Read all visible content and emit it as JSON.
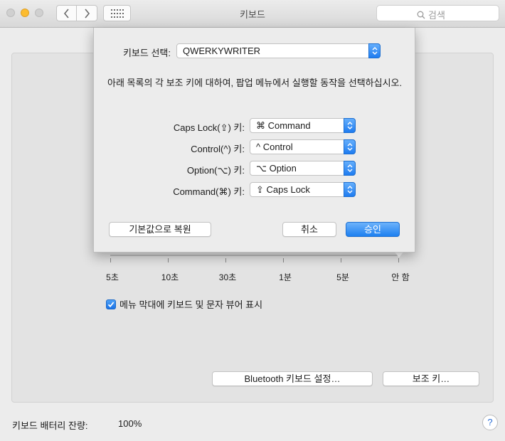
{
  "window": {
    "title": "키보드",
    "search_placeholder": "검색"
  },
  "sheet": {
    "keyboard_select_label": "키보드 선택:",
    "keyboard_select_value": "QWERKYWRITER",
    "description": "아래 목록의 각 보조 키에 대하여,  팝업 메뉴에서 실행할 동작을 선택하십시오.",
    "modifier_rows": [
      {
        "label": "Caps Lock(⇪) 키:",
        "value": "⌘ Command"
      },
      {
        "label": "Control(^) 키:",
        "value": "^ Control"
      },
      {
        "label": "Option(⌥) 키:",
        "value": "⌥ Option"
      },
      {
        "label": "Command(⌘) 키:",
        "value": "⇪ Caps Lock"
      }
    ],
    "restore_defaults_label": "기본값으로 복원",
    "cancel_label": "취소",
    "ok_label": "승인",
    "accent_color": "#1e80f0"
  },
  "panel": {
    "slider_ticks": [
      "5초",
      "10초",
      "30초",
      "1분",
      "5분",
      "안 함"
    ],
    "slider_selected": "안 함",
    "show_in_menubar_label": "메뉴 막대에 키보드 및 문자 뷰어 표시",
    "show_in_menubar_checked": true,
    "bluetooth_setup_label": "Bluetooth 키보드 설정…",
    "modifier_keys_label": "보조 키…"
  },
  "footer": {
    "battery_label": "키보드 배터리 잔량:",
    "battery_value": "100%",
    "help_label": "?"
  }
}
